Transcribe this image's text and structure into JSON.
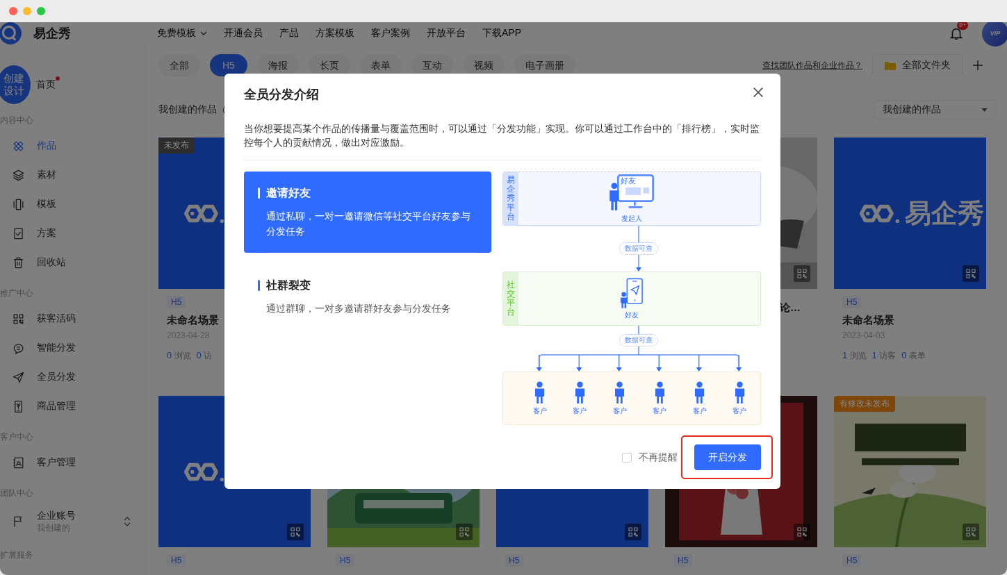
{
  "header": {
    "brand": "易企秀",
    "nav": [
      {
        "label": "免费模板",
        "dropdown": true
      },
      {
        "label": "开通会员",
        "dropdown": false
      },
      {
        "label": "产品",
        "dropdown": false
      },
      {
        "label": "方案模板",
        "dropdown": false
      },
      {
        "label": "客户案例",
        "dropdown": false
      },
      {
        "label": "开放平台",
        "dropdown": false
      },
      {
        "label": "下载APP",
        "dropdown": false
      }
    ],
    "notification_badge": "9+",
    "avatar_badge": "VIP"
  },
  "sidebar": {
    "create_button": "创建设计",
    "home": {
      "label": "首页",
      "unread": true
    },
    "sections": [
      {
        "title": "内容中心",
        "items": [
          {
            "kind": "link",
            "label": "作品",
            "selected": true
          },
          {
            "kind": "link",
            "label": "素材",
            "selected": false
          },
          {
            "kind": "link",
            "label": "模板",
            "selected": false
          },
          {
            "kind": "link",
            "label": "方案",
            "selected": false
          },
          {
            "kind": "link",
            "label": "回收站",
            "selected": false
          }
        ]
      },
      {
        "title": "推广中心",
        "items": [
          {
            "kind": "link",
            "label": "获客活码",
            "selected": false
          },
          {
            "kind": "link",
            "label": "智能分发",
            "selected": false
          },
          {
            "kind": "link",
            "label": "全员分发",
            "selected": false
          },
          {
            "kind": "link",
            "label": "商品管理",
            "selected": false
          }
        ]
      },
      {
        "title": "客户中心",
        "items": [
          {
            "kind": "link",
            "label": "客户管理",
            "selected": false
          }
        ]
      },
      {
        "title": "团队中心",
        "items": [
          {
            "kind": "account",
            "label": "企业账号",
            "sub": "我创建的",
            "selected": false
          }
        ]
      },
      {
        "title": "扩展服务"
      }
    ]
  },
  "filters": {
    "tabs": [
      {
        "label": "全部",
        "selected": false
      },
      {
        "label": "H5",
        "selected": true
      },
      {
        "label": "海报",
        "selected": false
      },
      {
        "label": "长页",
        "selected": false
      },
      {
        "label": "表单",
        "selected": false
      },
      {
        "label": "互动",
        "selected": false
      },
      {
        "label": "视频",
        "selected": false
      },
      {
        "label": "电子画册",
        "selected": false
      }
    ],
    "team_link": "查找团队作品和企业作品？",
    "folder_button": "全部文件夹"
  },
  "list_header": {
    "title": "我创建的作品（",
    "owner_filter": "我创建的作品"
  },
  "cards": [
    {
      "kind": "logo",
      "badge": {
        "text": "未发布",
        "color": "#2d2d2d"
      },
      "tag": "H5",
      "title": "未命名场景",
      "date": "2023-04-28",
      "stats": [
        {
          "count": "0",
          "label": "浏览"
        },
        {
          "count": "0",
          "label": "访"
        }
      ]
    },
    {
      "kind": "covered"
    },
    {
      "kind": "covered"
    },
    {
      "kind": "picture",
      "qr_code": true,
      "title": "论…",
      "title_cut": true
    },
    {
      "kind": "logo",
      "qr_code": true,
      "cover_text": "易企秀",
      "tag": "H5",
      "title": "未命名场景",
      "date": "2023-04-03",
      "stats": [
        {
          "count": "1",
          "label": "浏览"
        },
        {
          "count": "1",
          "label": "访客"
        },
        {
          "count": "0",
          "label": "表单"
        }
      ]
    },
    {
      "kind": "logo",
      "qr_code": true,
      "tag": "H5"
    },
    {
      "kind": "picture",
      "qr_code": true,
      "tag": "H5"
    },
    {
      "kind": "blank",
      "qr_code": true,
      "tag": "H5"
    },
    {
      "kind": "picture",
      "qr_code": true,
      "tag": "H5"
    },
    {
      "kind": "picture",
      "qr_code": true,
      "badge": {
        "text": "有修改未发布",
        "color": "#7d460b"
      },
      "tag": "H5"
    }
  ],
  "modal": {
    "title": "全员分发介绍",
    "description": "当你想要提高某个作品的传播量与覆盖范围时，可以通过「分发功能」实现。你可以通过工作台中的「排行榜」，实时监控每个人的贡献情况，做出对应激励。",
    "options": [
      {
        "title": "邀请好友",
        "description": "通过私聊，一对一邀请微信等社交平台好友参与分发任务",
        "selected": true
      },
      {
        "title": "社群裂变",
        "description": "通过群聊，一对多邀请群好友参与分发任务",
        "selected": false
      }
    ],
    "diagram": {
      "platform": {
        "label": "易企秀平台",
        "screen_label": "好友",
        "node": "发起人"
      },
      "link_1": "数据可查",
      "social": {
        "label": "社交平台",
        "node": "好友"
      },
      "link_2": "数据可查",
      "customers": [
        "客户",
        "客户",
        "客户",
        "客户",
        "客户",
        "客户"
      ]
    },
    "dont_remind": {
      "label": "不再提醒",
      "checked": false
    },
    "confirm_button": "开启分发"
  }
}
